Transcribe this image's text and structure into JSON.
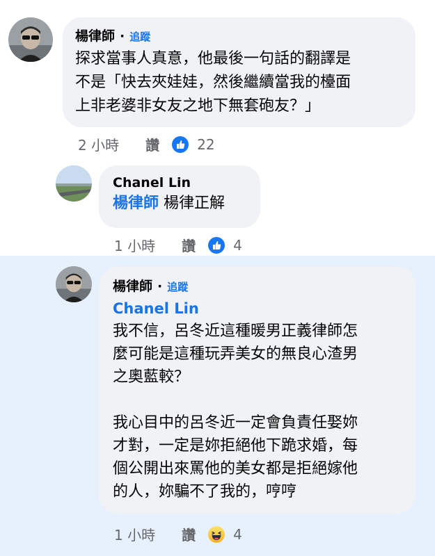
{
  "comments": [
    {
      "author": "楊律師",
      "separator": "·",
      "follow": "追蹤",
      "text": "探求當事人真意，他最後一句話的翻譯是\n不是「快去夾娃娃，然後繼續當我的檯面\n上非老婆非女友之地下無套砲友？」",
      "time": "2 小時",
      "like": "讚",
      "reaction": "like-icon",
      "reaction_count": "22"
    },
    {
      "author": "Chanel Lin",
      "mention": "楊律師",
      "text": " 楊律正解",
      "time": "1 小時",
      "like": "讚",
      "reaction": "like-icon",
      "reaction_count": "4"
    },
    {
      "author": "楊律師",
      "separator": "·",
      "follow": "追蹤",
      "mention": "Chanel Lin",
      "text": "我不信，呂冬近這種暖男正義律師怎\n麼可能是這種玩弄美女的無良心渣男\n之奧藍較？\n\n我心目中的呂冬近一定會負責任娶妳\n才對，一定是妳拒絕他下跪求婚，每\n個公開出來罵他的美女都是拒絕嫁他\n的人，妳騙不了我的，哼哼",
      "time": "1 小時",
      "like": "讚",
      "reaction": "haha-icon",
      "reaction_count": "4"
    }
  ],
  "colors": {
    "bubble": "#f0f2f5",
    "highlight": "#e7f0fd",
    "link_blue": "#1b74e4",
    "meta_gray": "#65676b"
  }
}
